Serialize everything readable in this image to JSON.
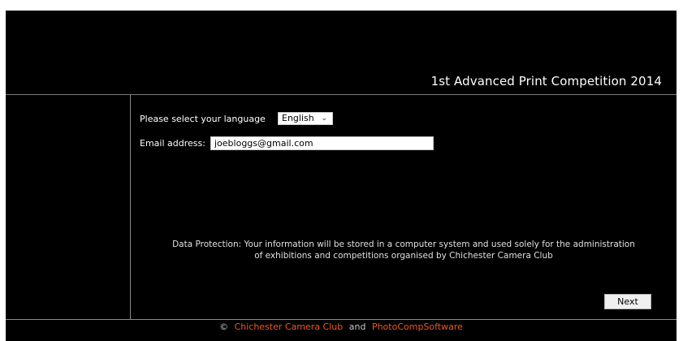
{
  "header": {
    "title": "1st Advanced Print Competition 2014"
  },
  "form": {
    "language_label": "Please select your language",
    "language_selected": "English",
    "email_label": "Email address:",
    "email_value": "joebloggs@gmail.com"
  },
  "notice": {
    "line1": "Data Protection: Your information will be stored in a computer system and used solely for the administration",
    "line2": "of exhibitions and competitions organised by Chichester Camera Club"
  },
  "actions": {
    "next_label": "Next"
  },
  "footer": {
    "copyright_symbol": "©",
    "club_link": "Chichester Camera Club",
    "and_text": "and",
    "software_link": "PhotoCompSoftware"
  },
  "colors": {
    "background": "#000000",
    "link": "#e85a2a"
  },
  "icons": {
    "select_chevron": "chevron-down-icon"
  }
}
